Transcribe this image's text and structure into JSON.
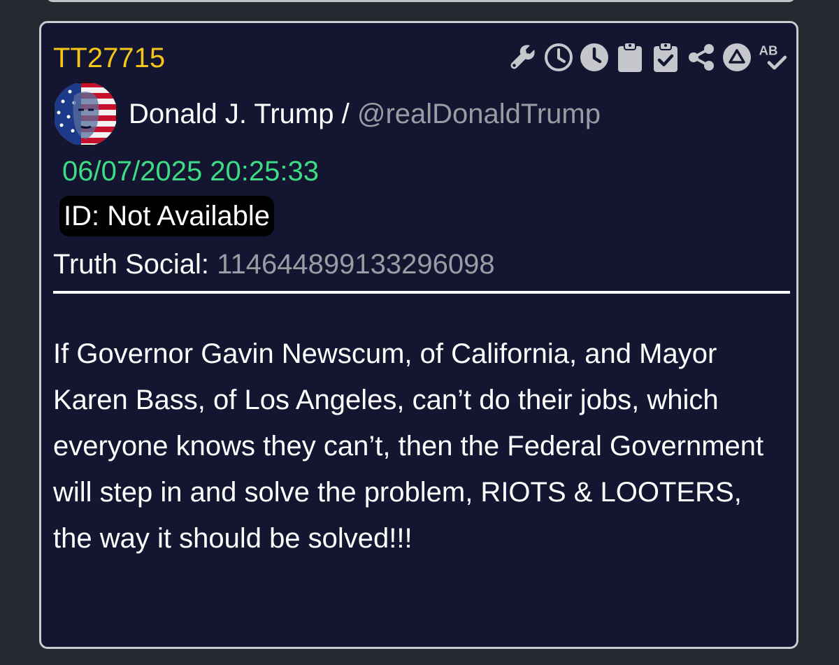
{
  "post": {
    "id": "TT27715",
    "author": {
      "name": "Donald J. Trump",
      "separator": "/",
      "handle": "@realDonaldTrump"
    },
    "timestamp": "06/07/2025 20:25:33",
    "id_label": "ID: Not Available",
    "truth_social": {
      "label": "Truth Social:",
      "value": "114644899133296098"
    },
    "body": "If Governor Gavin Newscum, of California, and Mayor Karen Bass, of Los Angeles, can’t do their jobs, which everyone knows they can’t, then the Federal Government will step in and solve the problem, RIOTS & LOOTERS, the way it should be solved!!!"
  },
  "toolbar": {
    "icons": [
      "wrench-icon",
      "clock-outline-icon",
      "clock-filled-icon",
      "clipboard-icon",
      "clipboard-check-icon",
      "share-icon",
      "triangle-circle-icon",
      "spellcheck-icon"
    ],
    "icon_text": "AB"
  },
  "colors": {
    "background": "#25282e",
    "card": "#141530",
    "border": "#c9cbd0",
    "post_id": "#f5c518",
    "timestamp": "#3ddc84",
    "muted": "#9a9ba3",
    "icon": "#c6c7cc"
  }
}
